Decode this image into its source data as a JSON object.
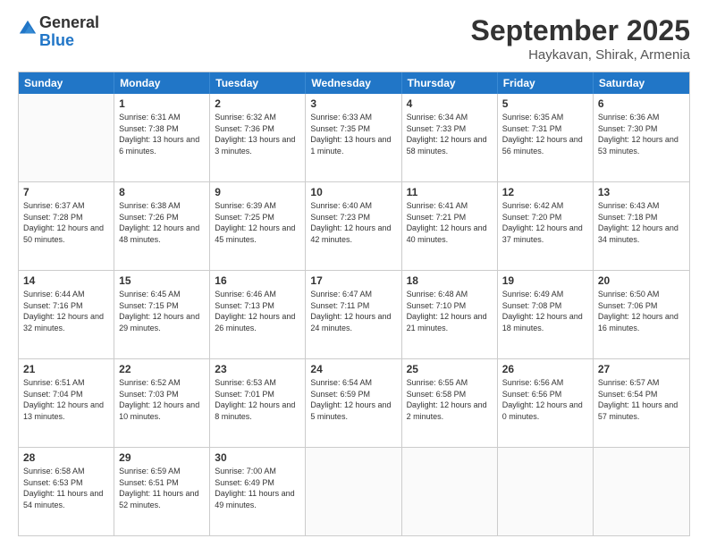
{
  "header": {
    "logo_general": "General",
    "logo_blue": "Blue",
    "month_title": "September 2025",
    "location": "Haykavan, Shirak, Armenia"
  },
  "calendar": {
    "days_of_week": [
      "Sunday",
      "Monday",
      "Tuesday",
      "Wednesday",
      "Thursday",
      "Friday",
      "Saturday"
    ],
    "rows": [
      [
        {
          "day": "",
          "sunrise": "",
          "sunset": "",
          "daylight": ""
        },
        {
          "day": "1",
          "sunrise": "Sunrise: 6:31 AM",
          "sunset": "Sunset: 7:38 PM",
          "daylight": "Daylight: 13 hours and 6 minutes."
        },
        {
          "day": "2",
          "sunrise": "Sunrise: 6:32 AM",
          "sunset": "Sunset: 7:36 PM",
          "daylight": "Daylight: 13 hours and 3 minutes."
        },
        {
          "day": "3",
          "sunrise": "Sunrise: 6:33 AM",
          "sunset": "Sunset: 7:35 PM",
          "daylight": "Daylight: 13 hours and 1 minute."
        },
        {
          "day": "4",
          "sunrise": "Sunrise: 6:34 AM",
          "sunset": "Sunset: 7:33 PM",
          "daylight": "Daylight: 12 hours and 58 minutes."
        },
        {
          "day": "5",
          "sunrise": "Sunrise: 6:35 AM",
          "sunset": "Sunset: 7:31 PM",
          "daylight": "Daylight: 12 hours and 56 minutes."
        },
        {
          "day": "6",
          "sunrise": "Sunrise: 6:36 AM",
          "sunset": "Sunset: 7:30 PM",
          "daylight": "Daylight: 12 hours and 53 minutes."
        }
      ],
      [
        {
          "day": "7",
          "sunrise": "Sunrise: 6:37 AM",
          "sunset": "Sunset: 7:28 PM",
          "daylight": "Daylight: 12 hours and 50 minutes."
        },
        {
          "day": "8",
          "sunrise": "Sunrise: 6:38 AM",
          "sunset": "Sunset: 7:26 PM",
          "daylight": "Daylight: 12 hours and 48 minutes."
        },
        {
          "day": "9",
          "sunrise": "Sunrise: 6:39 AM",
          "sunset": "Sunset: 7:25 PM",
          "daylight": "Daylight: 12 hours and 45 minutes."
        },
        {
          "day": "10",
          "sunrise": "Sunrise: 6:40 AM",
          "sunset": "Sunset: 7:23 PM",
          "daylight": "Daylight: 12 hours and 42 minutes."
        },
        {
          "day": "11",
          "sunrise": "Sunrise: 6:41 AM",
          "sunset": "Sunset: 7:21 PM",
          "daylight": "Daylight: 12 hours and 40 minutes."
        },
        {
          "day": "12",
          "sunrise": "Sunrise: 6:42 AM",
          "sunset": "Sunset: 7:20 PM",
          "daylight": "Daylight: 12 hours and 37 minutes."
        },
        {
          "day": "13",
          "sunrise": "Sunrise: 6:43 AM",
          "sunset": "Sunset: 7:18 PM",
          "daylight": "Daylight: 12 hours and 34 minutes."
        }
      ],
      [
        {
          "day": "14",
          "sunrise": "Sunrise: 6:44 AM",
          "sunset": "Sunset: 7:16 PM",
          "daylight": "Daylight: 12 hours and 32 minutes."
        },
        {
          "day": "15",
          "sunrise": "Sunrise: 6:45 AM",
          "sunset": "Sunset: 7:15 PM",
          "daylight": "Daylight: 12 hours and 29 minutes."
        },
        {
          "day": "16",
          "sunrise": "Sunrise: 6:46 AM",
          "sunset": "Sunset: 7:13 PM",
          "daylight": "Daylight: 12 hours and 26 minutes."
        },
        {
          "day": "17",
          "sunrise": "Sunrise: 6:47 AM",
          "sunset": "Sunset: 7:11 PM",
          "daylight": "Daylight: 12 hours and 24 minutes."
        },
        {
          "day": "18",
          "sunrise": "Sunrise: 6:48 AM",
          "sunset": "Sunset: 7:10 PM",
          "daylight": "Daylight: 12 hours and 21 minutes."
        },
        {
          "day": "19",
          "sunrise": "Sunrise: 6:49 AM",
          "sunset": "Sunset: 7:08 PM",
          "daylight": "Daylight: 12 hours and 18 minutes."
        },
        {
          "day": "20",
          "sunrise": "Sunrise: 6:50 AM",
          "sunset": "Sunset: 7:06 PM",
          "daylight": "Daylight: 12 hours and 16 minutes."
        }
      ],
      [
        {
          "day": "21",
          "sunrise": "Sunrise: 6:51 AM",
          "sunset": "Sunset: 7:04 PM",
          "daylight": "Daylight: 12 hours and 13 minutes."
        },
        {
          "day": "22",
          "sunrise": "Sunrise: 6:52 AM",
          "sunset": "Sunset: 7:03 PM",
          "daylight": "Daylight: 12 hours and 10 minutes."
        },
        {
          "day": "23",
          "sunrise": "Sunrise: 6:53 AM",
          "sunset": "Sunset: 7:01 PM",
          "daylight": "Daylight: 12 hours and 8 minutes."
        },
        {
          "day": "24",
          "sunrise": "Sunrise: 6:54 AM",
          "sunset": "Sunset: 6:59 PM",
          "daylight": "Daylight: 12 hours and 5 minutes."
        },
        {
          "day": "25",
          "sunrise": "Sunrise: 6:55 AM",
          "sunset": "Sunset: 6:58 PM",
          "daylight": "Daylight: 12 hours and 2 minutes."
        },
        {
          "day": "26",
          "sunrise": "Sunrise: 6:56 AM",
          "sunset": "Sunset: 6:56 PM",
          "daylight": "Daylight: 12 hours and 0 minutes."
        },
        {
          "day": "27",
          "sunrise": "Sunrise: 6:57 AM",
          "sunset": "Sunset: 6:54 PM",
          "daylight": "Daylight: 11 hours and 57 minutes."
        }
      ],
      [
        {
          "day": "28",
          "sunrise": "Sunrise: 6:58 AM",
          "sunset": "Sunset: 6:53 PM",
          "daylight": "Daylight: 11 hours and 54 minutes."
        },
        {
          "day": "29",
          "sunrise": "Sunrise: 6:59 AM",
          "sunset": "Sunset: 6:51 PM",
          "daylight": "Daylight: 11 hours and 52 minutes."
        },
        {
          "day": "30",
          "sunrise": "Sunrise: 7:00 AM",
          "sunset": "Sunset: 6:49 PM",
          "daylight": "Daylight: 11 hours and 49 minutes."
        },
        {
          "day": "",
          "sunrise": "",
          "sunset": "",
          "daylight": ""
        },
        {
          "day": "",
          "sunrise": "",
          "sunset": "",
          "daylight": ""
        },
        {
          "day": "",
          "sunrise": "",
          "sunset": "",
          "daylight": ""
        },
        {
          "day": "",
          "sunrise": "",
          "sunset": "",
          "daylight": ""
        }
      ]
    ]
  }
}
